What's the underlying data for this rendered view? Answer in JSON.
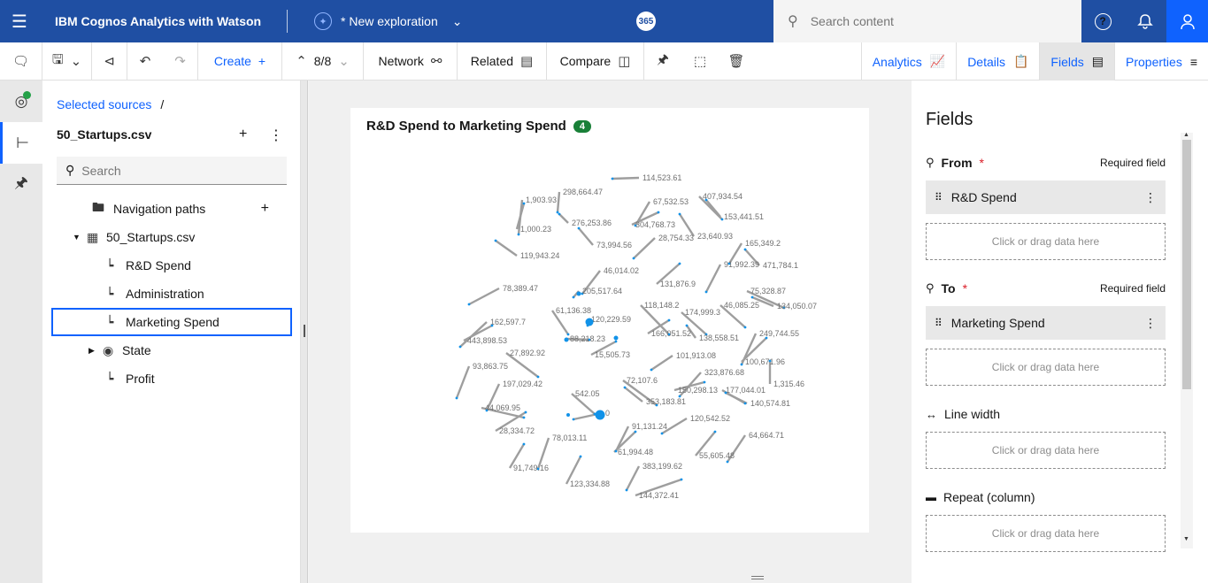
{
  "header": {
    "app_name": "IBM Cognos Analytics with Watson",
    "exploration_name": "* New exploration",
    "badge": "365",
    "search_placeholder": "Search content"
  },
  "toolbar": {
    "create_label": "Create",
    "pager": "8/8",
    "network_label": "Network",
    "related_label": "Related",
    "compare_label": "Compare",
    "analytics_label": "Analytics",
    "details_label": "Details",
    "fields_label": "Fields",
    "properties_label": "Properties"
  },
  "sources": {
    "breadcrumb": "Selected sources",
    "breadcrumb_sep": "/",
    "file_name": "50_Startups.csv",
    "search_placeholder": "Search",
    "tree": [
      {
        "label": "Navigation paths"
      },
      {
        "label": "50_Startups.csv"
      },
      {
        "label": "R&D Spend"
      },
      {
        "label": "Administration"
      },
      {
        "label": "Marketing Spend"
      },
      {
        "label": "State"
      },
      {
        "label": "Profit"
      }
    ]
  },
  "visualization": {
    "title": "R&D Spend to Marketing Spend",
    "badge": "4",
    "node_labels": [
      "114,523.61",
      "298,664.47",
      "1,903.93",
      "67,532.53",
      "407,934.54",
      "153,441.51",
      "276,253.86",
      "304,768.73",
      "1,000.23",
      "73,994.56",
      "28,754.33",
      "23,640.93",
      "165,349.2",
      "119,943.24",
      "91,992.39",
      "471,784.1",
      "46,014.02",
      "78,389.47",
      "131,876.9",
      "75,328.87",
      "205,517.64",
      "134,050.07",
      "61,136.38",
      "118,148.2",
      "174,999.3",
      "46,085.25",
      "120,229.59",
      "162,597.7",
      "88,218.23",
      "166,051.52",
      "138,558.51",
      "443,898.53",
      "249,744.55",
      "27,892.92",
      "15,505.73",
      "101,913.08",
      "100,671.96",
      "93,863.75",
      "323,876.68",
      "197,029.42",
      "72,107.6",
      "1,315.46",
      "150,298.13",
      "177,044.01",
      "542.05",
      "353,183.81",
      "140,574.81",
      "44,069.95",
      "0",
      "120,542.52",
      "28,334.72",
      "91,131.24",
      "64,664.71",
      "78,013.11",
      "61,994.48",
      "55,605.48",
      "91,749.16",
      "383,199.62",
      "123,334.88",
      "144,372.41"
    ]
  },
  "fields": {
    "title": "Fields",
    "from_label": "From",
    "to_label": "To",
    "required_text": "Required field",
    "from_value": "R&D Spend",
    "to_value": "Marketing Spend",
    "drop_text": "Click or drag data here",
    "line_width_label": "Line width",
    "repeat_label": "Repeat (column)"
  }
}
